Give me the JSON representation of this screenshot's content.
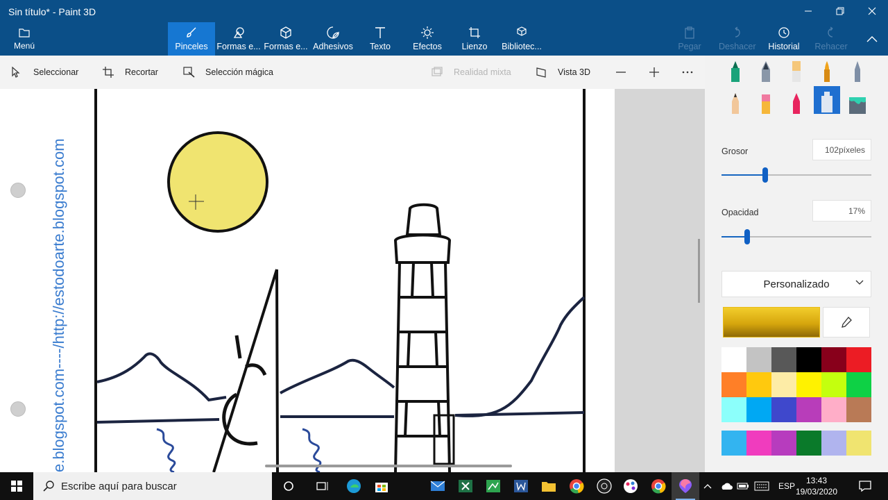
{
  "window": {
    "title": "Sin título* - Paint 3D"
  },
  "ribbon": {
    "menu_label": "Menú",
    "tools": [
      {
        "label": "Pinceles",
        "active": true
      },
      {
        "label": "Formas e..."
      },
      {
        "label": "Formas e..."
      },
      {
        "label": "Adhesivos"
      },
      {
        "label": "Texto"
      },
      {
        "label": "Efectos"
      },
      {
        "label": "Lienzo"
      },
      {
        "label": "Bibliotec..."
      }
    ],
    "right": [
      {
        "label": "Pegar",
        "disabled": true
      },
      {
        "label": "Deshacer",
        "disabled": true
      },
      {
        "label": "Historial",
        "disabled": false
      },
      {
        "label": "Rehacer",
        "disabled": true
      }
    ]
  },
  "subbar": {
    "select": "Seleccionar",
    "crop": "Recortar",
    "magic": "Selección mágica",
    "mixed": "Realidad mixta",
    "view3d": "Vista 3D"
  },
  "canvas": {
    "watermark": "e.blogspot.com----/http://estodoarte.blogspot.com"
  },
  "panel": {
    "grosor_label": "Grosor",
    "grosor_value": "102píxeles",
    "grosor_fraction": 0.29,
    "opacidad_label": "Opacidad",
    "opacidad_value": "17%",
    "opacidad_fraction": 0.17,
    "dropdown_label": "Personalizado",
    "current_color": "#e9bc17",
    "palette": [
      "#ffffff",
      "#c3c3c3",
      "#585858",
      "#000000",
      "#88001b",
      "#ec1c24",
      "#ff7f27",
      "#ffc90e",
      "#fdeca6",
      "#fff200",
      "#c4ff0e",
      "#0ed145",
      "#8cfffb",
      "#00a8f3",
      "#3f48cc",
      "#b83dba",
      "#ffaec8",
      "#b97a56"
    ],
    "custom_palette": [
      "#33b4f0",
      "#f03cbe",
      "#b73cbe",
      "#0a7a2a",
      "#b0b4ee",
      "#f0e470"
    ]
  },
  "taskbar": {
    "search_placeholder": "Escribe aquí para buscar",
    "lang": "ESP",
    "time": "13:43",
    "date": "19/03/2020"
  }
}
